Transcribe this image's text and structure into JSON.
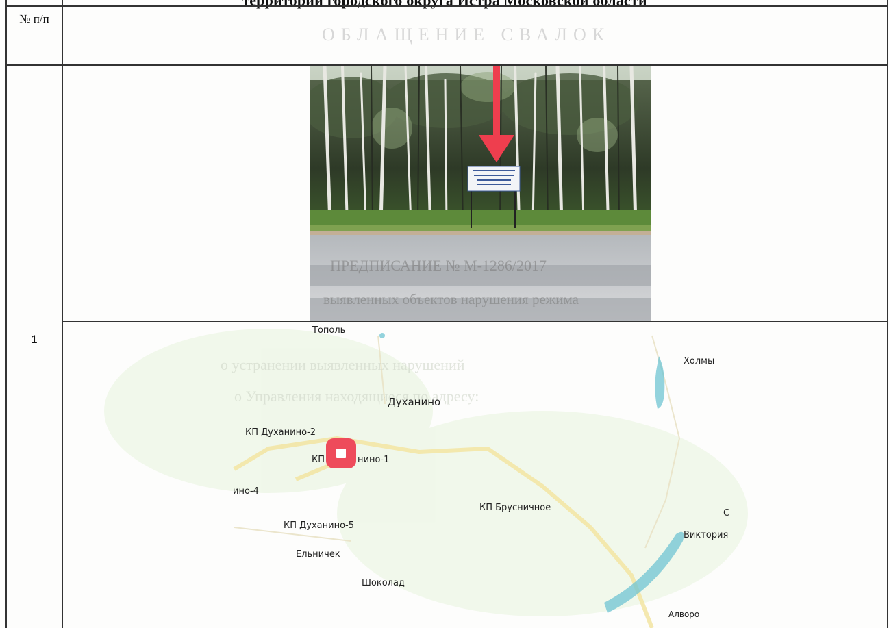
{
  "document": {
    "title": "территории городского округа Истра Московской области"
  },
  "table": {
    "header_number": "№ п/п",
    "rows": [
      {
        "number": "1"
      }
    ]
  },
  "photo": {
    "sign_lines": [
      "Продажа земельных",
      "участков",
      "8 000 000 000"
    ]
  },
  "map": {
    "labels": {
      "topol": "Тополь",
      "kholmy": "Холмы",
      "dukhanino": "Духанино",
      "kp_dukhanino_2": "КП Духанино-2",
      "kp_dukhanino_1_a": "КП",
      "kp_dukhanino_1_b": "нино-1",
      "dukhanino_4": "ино-4",
      "kp_brusnichnoe": "КП Брусничное",
      "c_label": "С",
      "kp_dukhanino_5": "КП Духанино-5",
      "viktoriya": "Виктория",
      "elnichek": "Ельничек",
      "shokolad": "Шоколад",
      "alvoro": "Алворо"
    },
    "colors": {
      "marker": "#ee4b5b",
      "road": "#f3e6a6",
      "water": "#6fc4d3"
    }
  },
  "bleed_through": {
    "header_line": "ОБЛАЩЕНИЕ СВАЛОК",
    "photo_line1": "ПРЕДПИСАНИЕ № М-1286/2017",
    "photo_line2": "выявленных объектов нарушения режима",
    "map_line1": "о устранении выявленных нарушений",
    "map_line2": "о Управления находящиеся по адресу:"
  }
}
